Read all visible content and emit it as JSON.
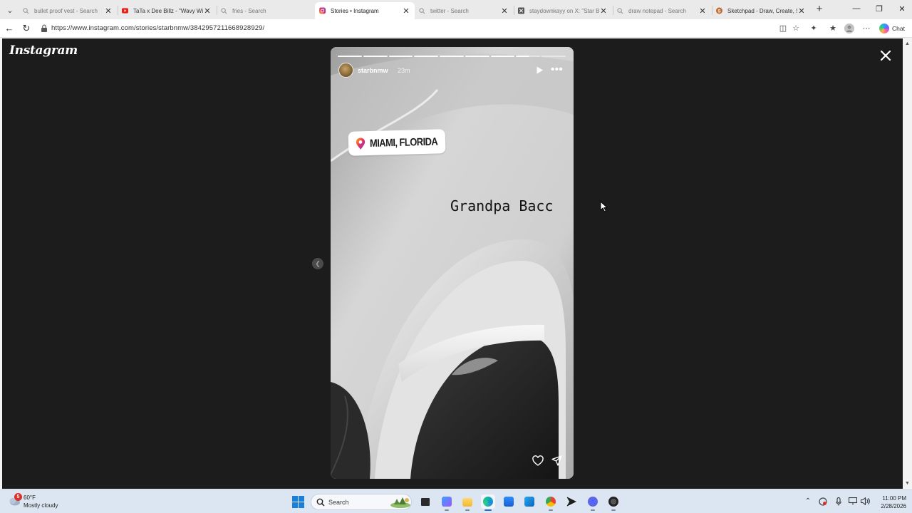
{
  "browser": {
    "tabs": [
      {
        "title": "bullet proof vest - Search",
        "icon": "search-icon",
        "active": false
      },
      {
        "title": "TaTa x Dee Billz - \"Wavy Wit",
        "icon": "youtube-icon",
        "active": false
      },
      {
        "title": "fries - Search",
        "icon": "search-icon",
        "active": false
      },
      {
        "title": "Stories • Instagram",
        "icon": "instagram-icon",
        "active": true
      },
      {
        "title": "twitter - Search",
        "icon": "search-icon",
        "active": false
      },
      {
        "title": "staydownkayy on X: \"Star B",
        "icon": "x-icon",
        "active": false
      },
      {
        "title": "draw notepad - Search",
        "icon": "search-icon",
        "active": false
      },
      {
        "title": "Sketchpad - Draw, Create, Sh",
        "icon": "sketchpad-icon",
        "active": false
      }
    ],
    "url": "https://www.instagram.com/stories/starbnmw/3842957211668928929/",
    "chat_label": "Chat"
  },
  "story_viewer": {
    "brand": "Instagram",
    "progress": {
      "segments_total": 8,
      "segments_done": 7,
      "current_fill": 0.55
    },
    "story": {
      "username": "starbnmw",
      "time_ago": "23m",
      "location_sticker": "MIAMI, FLORIDA",
      "caption": "Grandpa Bacc"
    }
  },
  "taskbar": {
    "weather": {
      "temp": "60°F",
      "condition": "Mostly cloudy",
      "badge": "5"
    },
    "search_placeholder": "Search",
    "clock": {
      "time": "11:00 PM",
      "date": "2/28/2026"
    }
  }
}
